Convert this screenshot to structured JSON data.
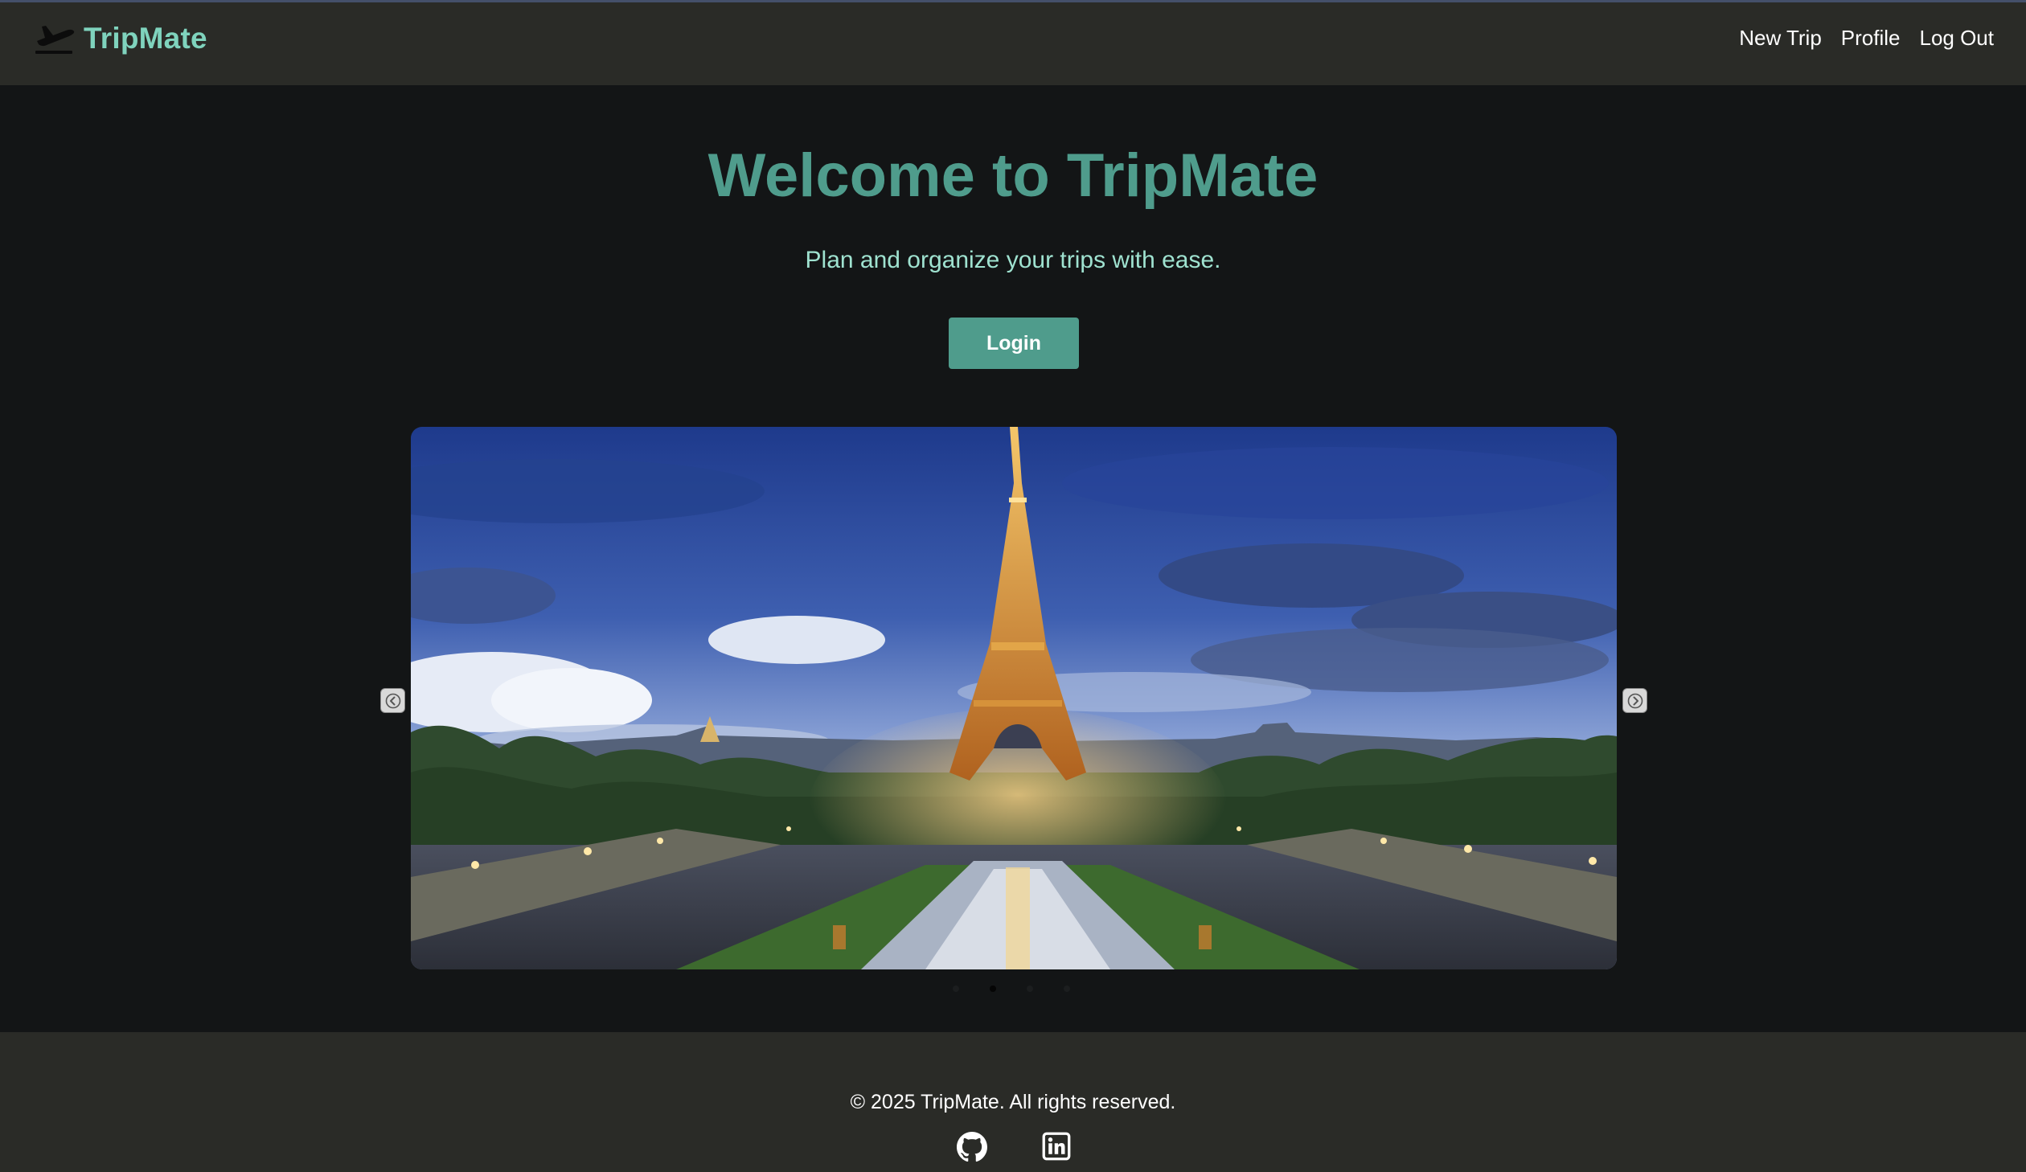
{
  "navbar": {
    "brand": "TripMate",
    "brand_icon": "airplane-departure-icon",
    "links": [
      "New Trip",
      "Profile",
      "Log Out"
    ]
  },
  "hero": {
    "title": "Welcome to TripMate",
    "subtitle": "Plan and organize your trips with ease.",
    "login_label": "Login"
  },
  "carousel": {
    "slide_count": 4,
    "active_slide": 2,
    "prev_icon": "chevron-left-icon",
    "next_icon": "chevron-right-icon"
  },
  "footer": {
    "copyright": "© 2025 TripMate. All rights reserved.",
    "social_icons": [
      "github-icon",
      "linkedin-icon"
    ]
  },
  "colors": {
    "accent": "#4f9c8c",
    "brand": "#7fd3bd",
    "subtitle": "#9fe2d0",
    "bar_background": "#2a2b27",
    "page_background": "#131516"
  }
}
